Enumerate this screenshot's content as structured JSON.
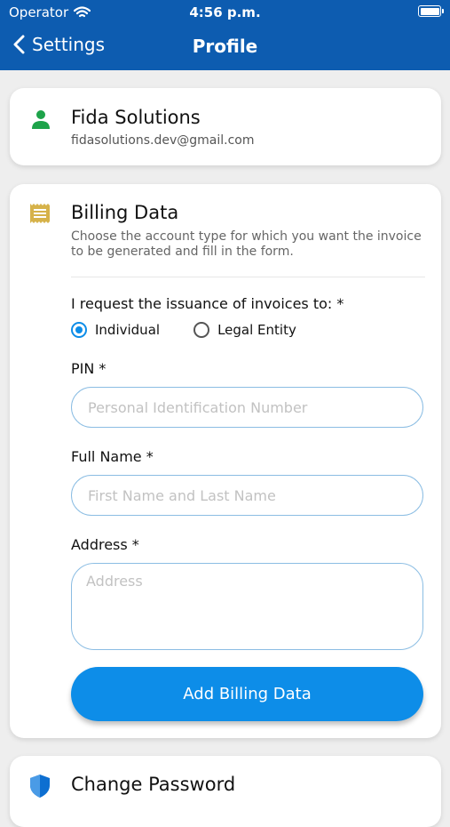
{
  "status_bar": {
    "carrier": "Operator",
    "time": "4:56 p.m."
  },
  "nav": {
    "back_label": "Settings",
    "title": "Profile"
  },
  "user": {
    "name": "Fida Solutions",
    "email": "fidasolutions.dev@gmail.com"
  },
  "billing": {
    "title": "Billing Data",
    "description": "Choose the account type for which you want the invoice to be generated and fill in the form.",
    "invoice_question": "I request the issuance of invoices to: *",
    "options": [
      "Individual",
      "Legal Entity"
    ],
    "selected_option": "Individual",
    "pin": {
      "label": "PIN *",
      "placeholder": "Personal Identification Number",
      "value": ""
    },
    "full_name": {
      "label": "Full Name *",
      "placeholder": "First Name and Last Name",
      "value": ""
    },
    "address": {
      "label": "Address *",
      "placeholder": "Address",
      "value": ""
    },
    "submit_label": "Add Billing Data"
  },
  "password": {
    "title": "Change Password"
  },
  "colors": {
    "header": "#0d5cb0",
    "accent": "#0d8de8",
    "user_icon": "#1ea34a",
    "billing_icon": "#d6b24a",
    "shield_icon": "#0d6fd1"
  }
}
